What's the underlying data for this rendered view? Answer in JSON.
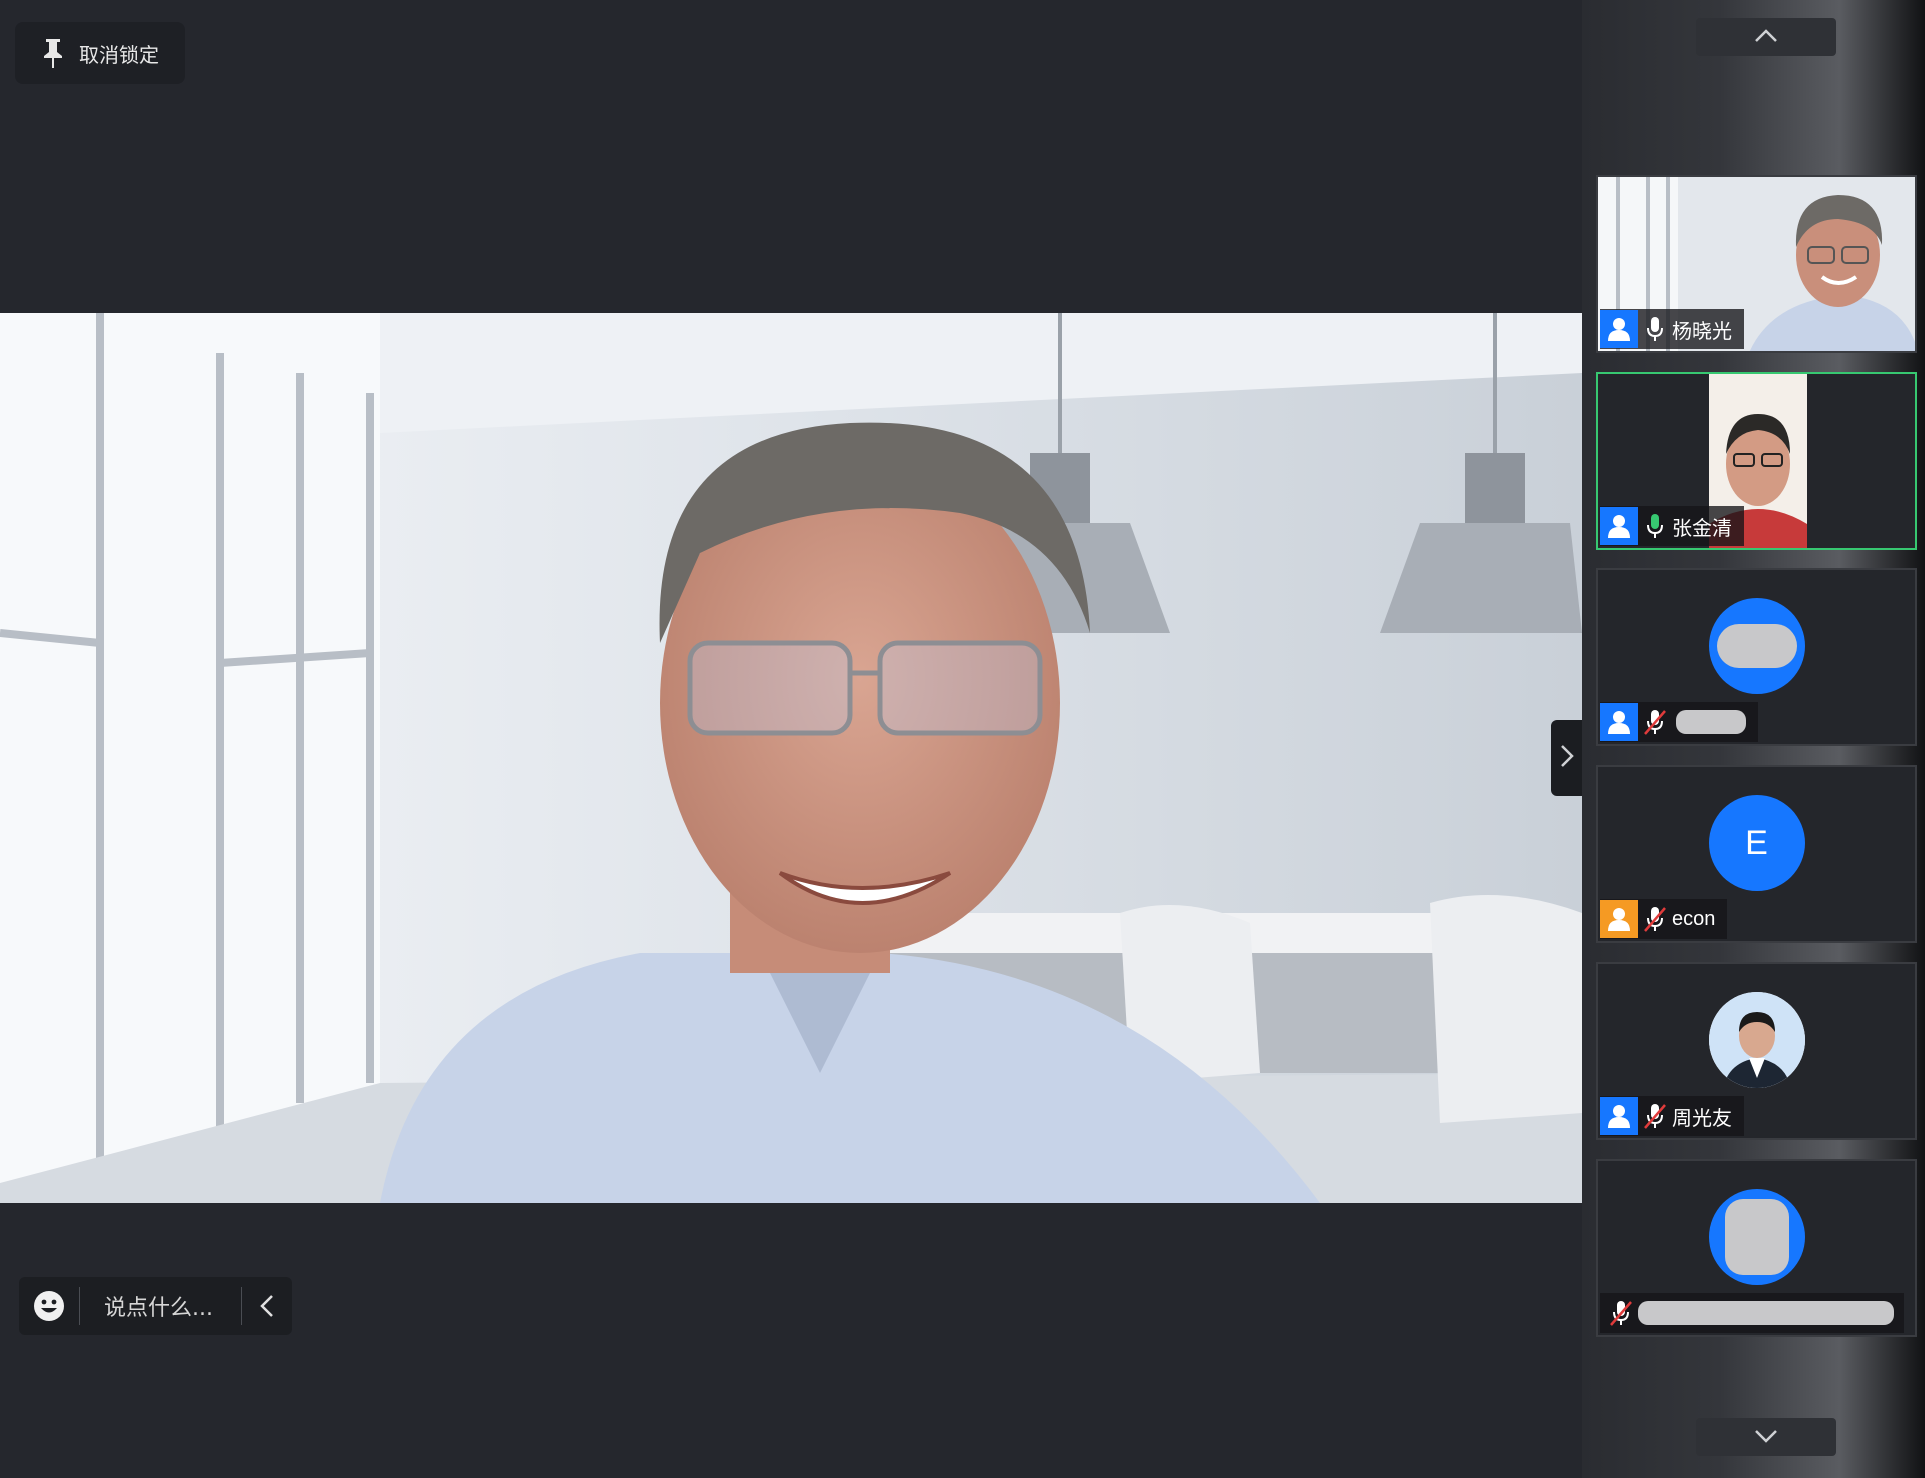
{
  "stage": {
    "unpin_label": "取消锁定",
    "chat_placeholder": "说点什么..."
  },
  "participants": [
    {
      "name": "杨晓光",
      "mic": "on",
      "role_color": "#1677ff",
      "video": "on"
    },
    {
      "name": "张金清",
      "mic": "speaking",
      "role_color": "#1677ff",
      "video": "on",
      "active": true
    },
    {
      "name": "",
      "mic": "muted",
      "role_color": "#1677ff",
      "video": "off"
    },
    {
      "name": "econ",
      "initial": "E",
      "mic": "muted",
      "role_color": "#f59a23",
      "video": "off"
    },
    {
      "name": "周光友",
      "mic": "muted",
      "role_color": "#1677ff",
      "video": "photo"
    },
    {
      "name": "",
      "mic": "muted",
      "video": "off"
    }
  ],
  "colors": {
    "accent_blue": "#1677ff",
    "speaking_green": "#37c871",
    "host_orange": "#f59a23",
    "muted_red": "#e03b3b"
  },
  "icons": [
    "pin-icon",
    "emoji-icon",
    "chevron-left-icon",
    "chevron-right-icon",
    "chevron-up-icon",
    "chevron-down-icon",
    "person-icon",
    "mic-icon",
    "mic-muted-icon"
  ]
}
